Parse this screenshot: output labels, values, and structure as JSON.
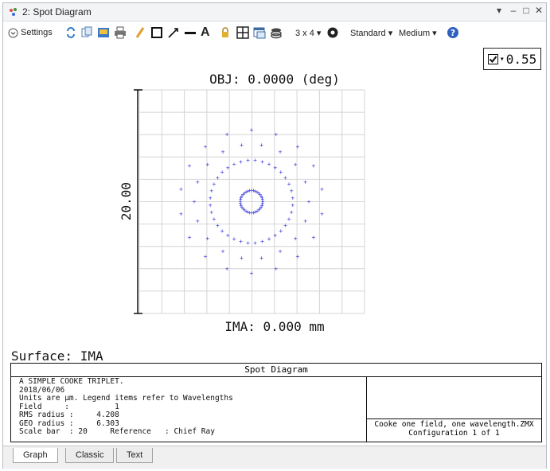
{
  "window": {
    "title": "2: Spot Diagram",
    "controls": {
      "dropdown": "▾",
      "minimize": "–",
      "maximize": "□",
      "close": "✕"
    }
  },
  "toolbar": {
    "settings_label": "Settings",
    "layout_label": "3 x 4 ▾",
    "standard_label": "Standard ▾",
    "medium_label": "Medium ▾",
    "text_tool_glyph": "A"
  },
  "wavelength": {
    "value": "0.55",
    "arrow": "▾"
  },
  "plot": {
    "obj_label": "OBJ: 0.0000 (deg)",
    "ima_label": "IMA: 0.000 mm",
    "scale_label": "20.00",
    "surface_label": "Surface: IMA"
  },
  "info": {
    "header": "Spot Diagram",
    "lines": [
      "A SIMPLE COOKE TRIPLET.",
      "2018/06/06",
      "Units are µm. Legend items refer to Wavelengths",
      "Field     :          1",
      "RMS radius :     4.208",
      "GEO radius :     6.303",
      "Scale bar  : 20     Reference   : Chief Ray"
    ],
    "right_lines": [
      "Cooke one field, one wavelength.ZMX",
      "Configuration 1 of 1"
    ]
  },
  "tabs": [
    "Graph",
    "Classic",
    "Text"
  ],
  "colors": {
    "spot": "#3a3ae0",
    "grid": "#d4d4d4",
    "help": "#2f5fbf"
  }
}
